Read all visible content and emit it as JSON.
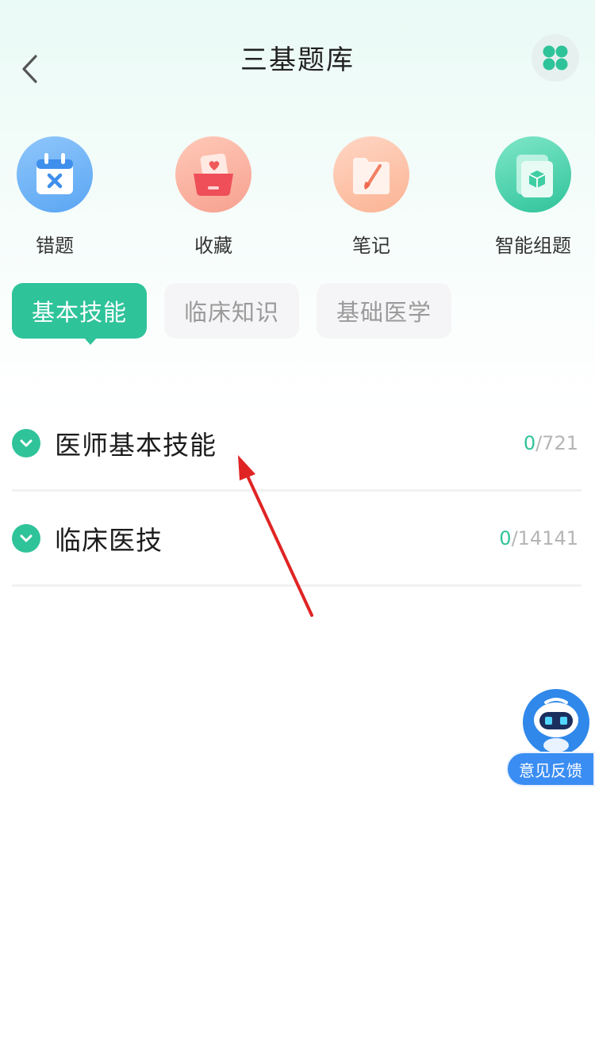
{
  "header": {
    "title": "三基题库",
    "back_icon": "chevron-left-icon",
    "menu_icon": "grid-four-dots-icon"
  },
  "shortcuts": [
    {
      "label": "错题",
      "icon": "calendar-x-icon",
      "color": "#4a9bf0"
    },
    {
      "label": "收藏",
      "icon": "heart-card-icon",
      "color": "#f26b6b"
    },
    {
      "label": "笔记",
      "icon": "folder-brush-icon",
      "color": "#f5906e"
    },
    {
      "label": "智能组题",
      "icon": "cube-card-icon",
      "color": "#2fc39a"
    }
  ],
  "tabs": [
    {
      "label": "基本技能",
      "active": true
    },
    {
      "label": "临床知识",
      "active": false
    },
    {
      "label": "基础医学",
      "active": false
    }
  ],
  "categories": [
    {
      "title": "医师基本技能",
      "done": "0",
      "total": "/721"
    },
    {
      "title": "临床医技",
      "done": "0",
      "total": "/14141"
    }
  ],
  "feedback": {
    "label": "意见反馈",
    "icon": "robot-icon"
  },
  "colors": {
    "accent": "#2fc39a",
    "annotation_arrow": "#e02424",
    "feedback_blue": "#3a8df2"
  }
}
